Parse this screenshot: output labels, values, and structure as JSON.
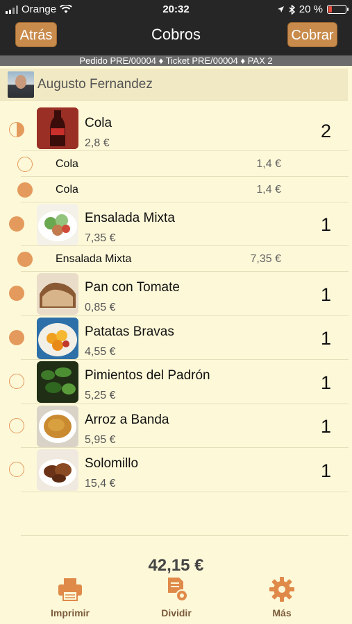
{
  "status_bar": {
    "carrier": "Orange",
    "time": "20:32",
    "battery": "20 %"
  },
  "nav": {
    "back_label": "Atrás",
    "title": "Cobros",
    "charge_label": "Cobrar"
  },
  "info_bar": "Pedido PRE/00004 ♦ Ticket PRE/00004 ♦ PAX 2",
  "customer": {
    "name": "Augusto Fernandez"
  },
  "items": [
    {
      "name": "Cola",
      "price": "2,8 €",
      "qty": "2",
      "state": "half",
      "subitems": [
        {
          "name": "Cola",
          "price": "1,4 €",
          "state": "empty"
        },
        {
          "name": "Cola",
          "price": "1,4 €",
          "state": "filled"
        }
      ]
    },
    {
      "name": "Ensalada Mixta",
      "price": "7,35 €",
      "qty": "1",
      "state": "filled",
      "subitems": [
        {
          "name": "Ensalada Mixta",
          "price": "7,35 €",
          "state": "filled"
        }
      ]
    },
    {
      "name": "Pan con Tomate",
      "price": "0,85 €",
      "qty": "1",
      "state": "filled"
    },
    {
      "name": "Patatas Bravas",
      "price": "4,55 €",
      "qty": "1",
      "state": "filled"
    },
    {
      "name": "Pimientos del Padrón",
      "price": "5,25 €",
      "qty": "1",
      "state": "empty"
    },
    {
      "name": "Arroz a Banda",
      "price": "5,95 €",
      "qty": "1",
      "state": "empty"
    },
    {
      "name": "Solomillo",
      "price": "15,4 €",
      "qty": "1",
      "state": "empty"
    }
  ],
  "total": "42,15 €",
  "tabs": [
    {
      "label": "Imprimir",
      "icon": "printer-icon"
    },
    {
      "label": "Dividir",
      "icon": "split-document-icon"
    },
    {
      "label": "Más",
      "icon": "gear-icon"
    }
  ],
  "colors": {
    "accent": "#e49a5c",
    "button": "#c98b4c",
    "background": "#fdf8d8",
    "bar": "#262626"
  }
}
